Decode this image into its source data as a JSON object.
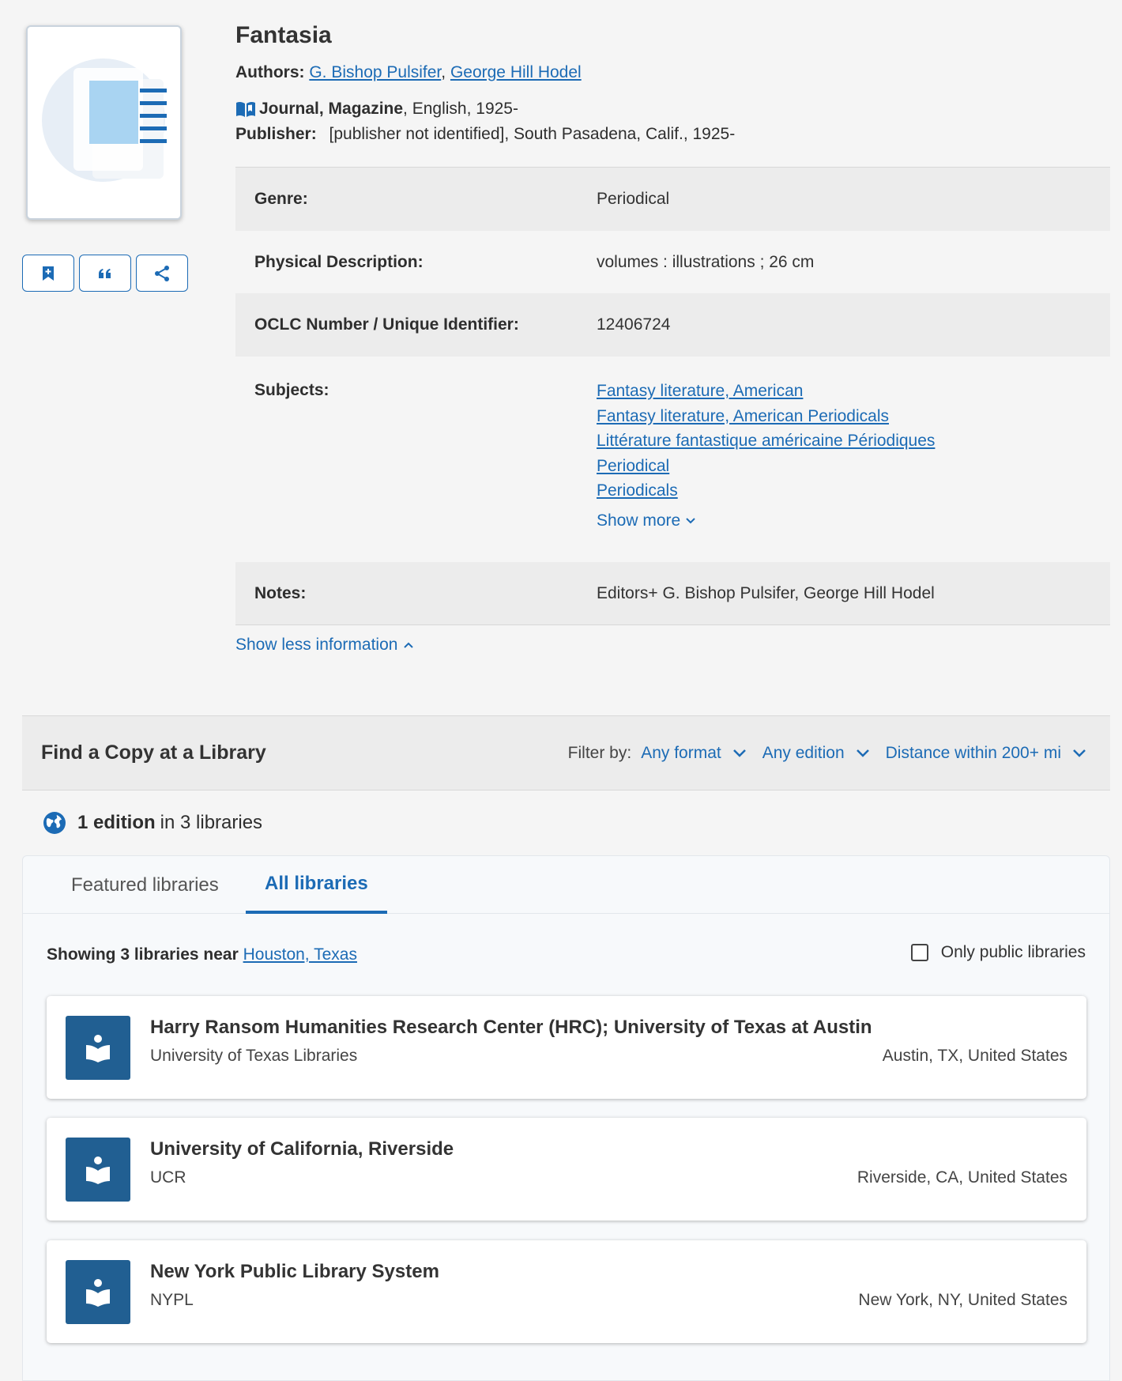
{
  "record": {
    "title": "Fantasia",
    "authors_label": "Authors:",
    "authors": [
      "G. Bishop Pulsifer",
      "George Hill Hodel"
    ],
    "format_bold": "Journal, Magazine",
    "format_rest": ", English, 1925-",
    "publisher_label": "Publisher:",
    "publisher_value": "[publisher not identified], South Pasadena, Calif., 1925-"
  },
  "details": {
    "genre_label": "Genre:",
    "genre_value": "Periodical",
    "phys_label": "Physical Description:",
    "phys_value": "volumes : illustrations ; 26 cm",
    "oclc_label": "OCLC Number / Unique Identifier:",
    "oclc_value": "12406724",
    "subjects_label": "Subjects:",
    "subjects": [
      "Fantasy literature, American",
      "Fantasy literature, American Periodicals",
      "Littérature fantastique américaine Périodiques",
      "Periodical",
      "Periodicals"
    ],
    "show_more": "Show more",
    "notes_label": "Notes:",
    "notes_value": "Editors+ G. Bishop Pulsifer, George Hill Hodel",
    "show_less": "Show less information"
  },
  "find_copy": {
    "title": "Find a Copy at a Library",
    "filter_label": "Filter by:",
    "format_filter": "Any format",
    "edition_filter": "Any edition",
    "distance_filter": "Distance within 200+ mi"
  },
  "editions": {
    "count_bold": "1 edition",
    "rest": "in 3 libraries"
  },
  "tabs": {
    "featured": "Featured libraries",
    "all": "All libraries"
  },
  "showing": {
    "bold": "Showing 3 libraries near",
    "location": "Houston, Texas",
    "public_only": "Only public libraries"
  },
  "libraries": [
    {
      "name": "Harry Ransom Humanities Research Center (HRC); University of Texas at Austin",
      "system": "University of Texas Libraries",
      "location": "Austin, TX, United States"
    },
    {
      "name": "University of California, Riverside",
      "system": "UCR",
      "location": "Riverside, CA, United States"
    },
    {
      "name": "New York Public Library System",
      "system": "NYPL",
      "location": "New York, NY, United States"
    }
  ],
  "colors": {
    "accent": "#1c6bb5",
    "library_icon_bg": "#215f92"
  }
}
